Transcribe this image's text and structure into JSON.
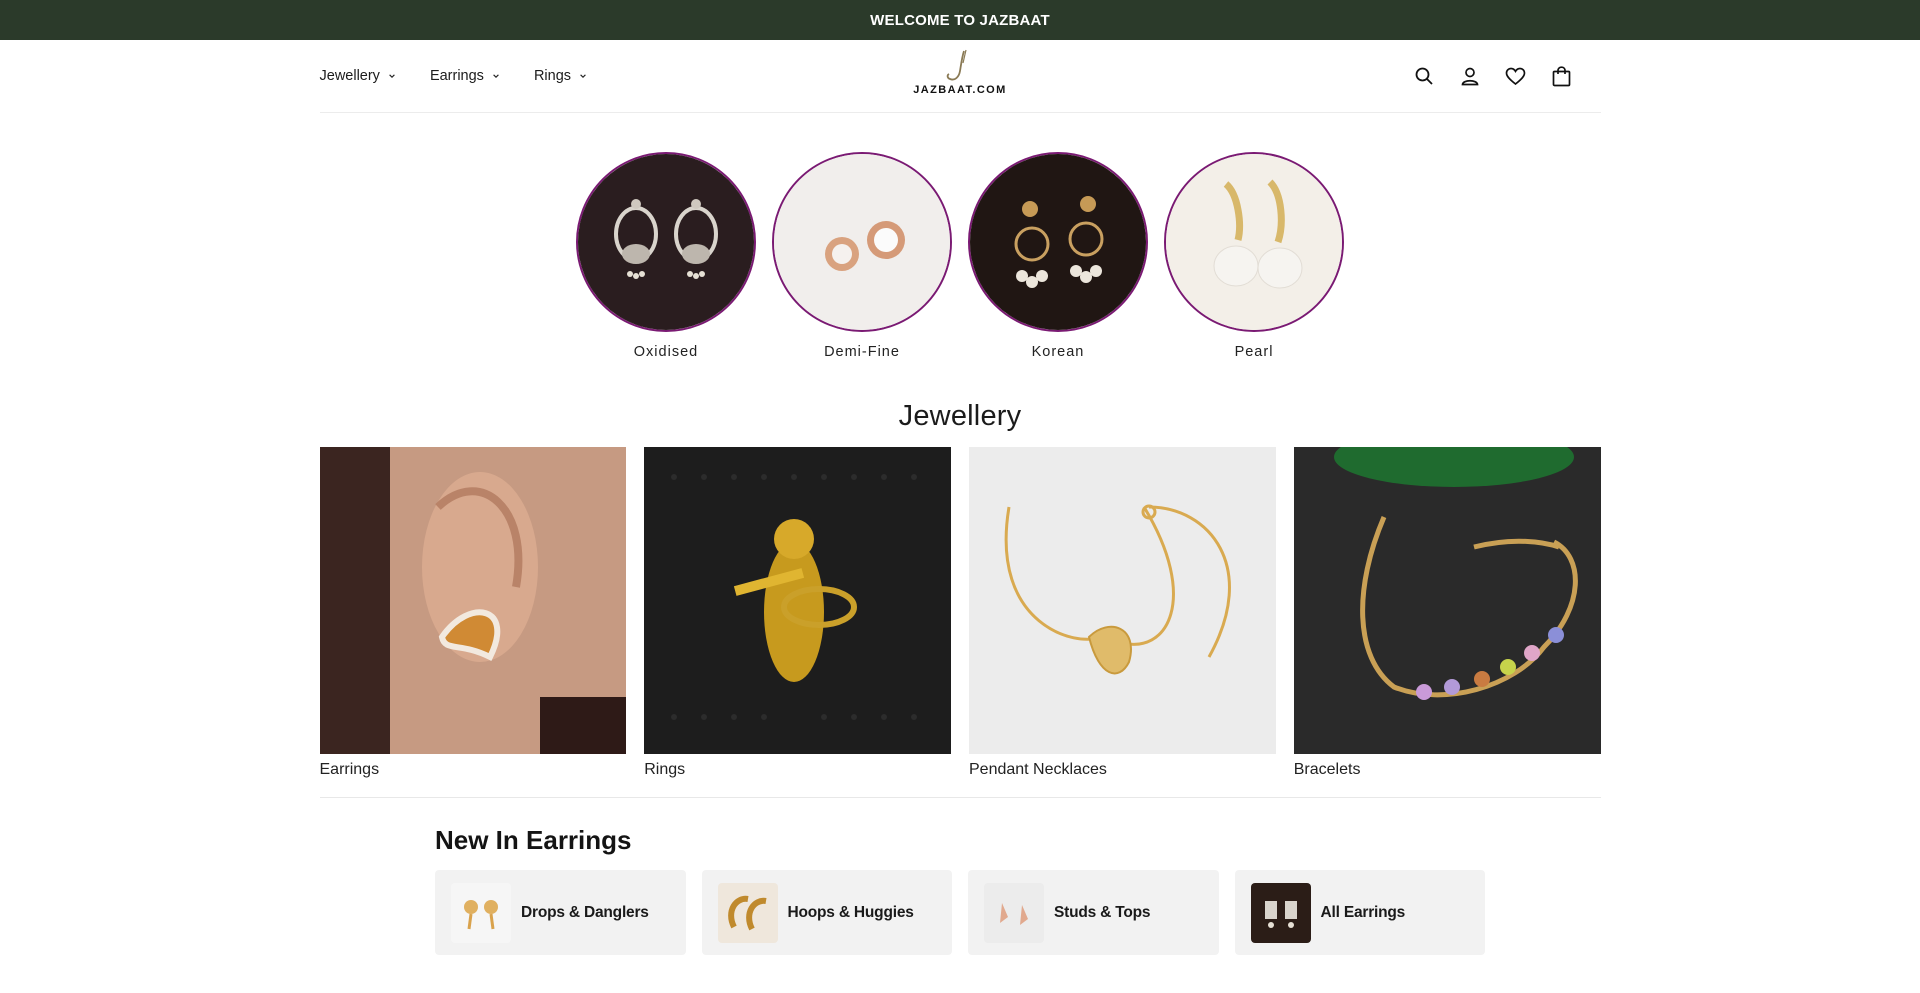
{
  "announcement": "WELCOME TO JAZBAAT",
  "header": {
    "nav": [
      {
        "label": "Jewellery"
      },
      {
        "label": "Earrings"
      },
      {
        "label": "Rings"
      }
    ],
    "logo_text": "JAZBAAT.COM",
    "icons": [
      "search-icon",
      "account-icon",
      "wishlist-icon",
      "cart-icon"
    ]
  },
  "categories_circle": [
    {
      "label": "Oxidised"
    },
    {
      "label": "Demi-Fine"
    },
    {
      "label": "Korean"
    },
    {
      "label": "Pearl"
    }
  ],
  "jewellery": {
    "title": "Jewellery",
    "items": [
      {
        "label": "Earrings"
      },
      {
        "label": "Rings"
      },
      {
        "label": "Pendant Necklaces"
      },
      {
        "label": "Bracelets"
      }
    ]
  },
  "new_in": {
    "title": "New In Earrings",
    "items": [
      {
        "label": "Drops & Danglers"
      },
      {
        "label": "Hoops & Huggies"
      },
      {
        "label": "Studs & Tops"
      },
      {
        "label": "All Earrings"
      }
    ]
  },
  "colors": {
    "announcement_bg": "#2b3a2a",
    "circle_border": "#7a1a73",
    "pill_bg": "#f2f2f2"
  }
}
